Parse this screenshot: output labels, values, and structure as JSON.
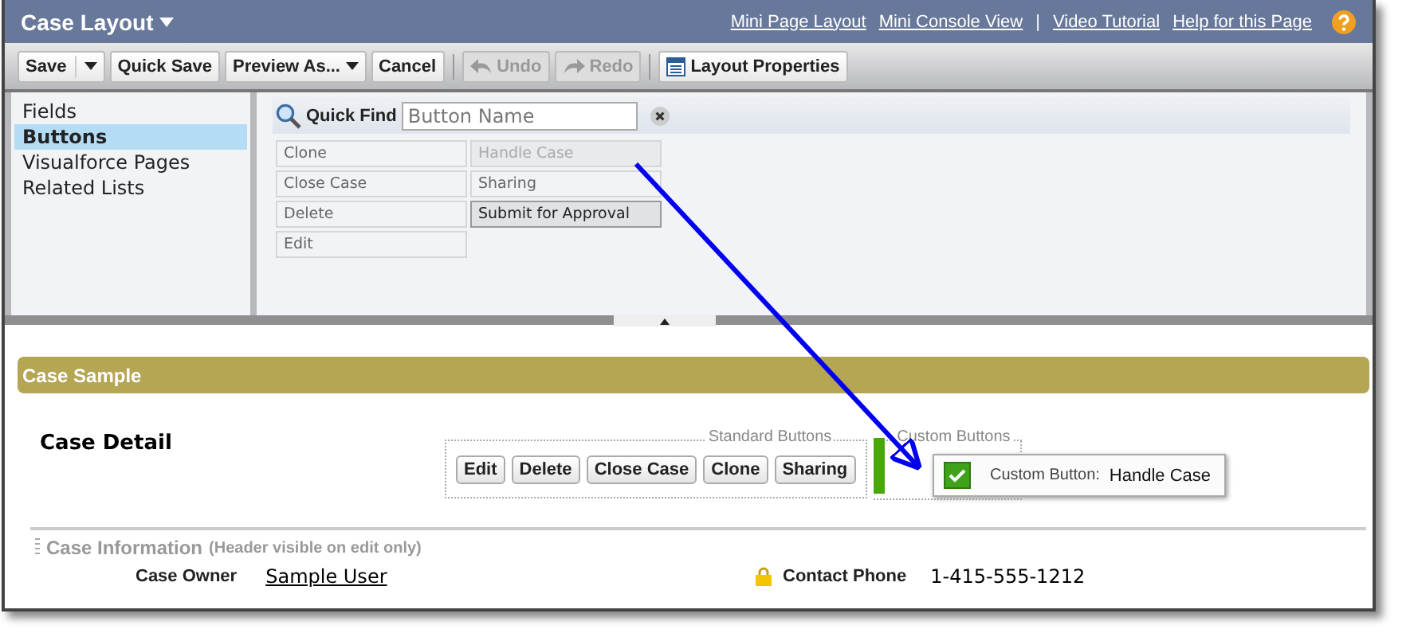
{
  "header": {
    "title": "Case Layout",
    "links": [
      {
        "label": "Mini Page Layout",
        "kind": "link"
      },
      {
        "label": "Mini Console View",
        "kind": "link"
      },
      {
        "label": "|",
        "kind": "separator"
      },
      {
        "label": "Video Tutorial",
        "kind": "link"
      },
      {
        "label": "Help for this Page",
        "kind": "link"
      }
    ]
  },
  "toolbar": [
    {
      "label": "Save",
      "kind": "split",
      "disabled": false
    },
    {
      "label": "Quick Save",
      "kind": "plain",
      "disabled": false
    },
    {
      "label": "Preview As...",
      "kind": "dropdown",
      "disabled": false
    },
    {
      "label": "Cancel",
      "kind": "plain",
      "disabled": false
    },
    {
      "label": "Undo",
      "kind": "undo",
      "disabled": true
    },
    {
      "label": "Redo",
      "kind": "redo",
      "disabled": true
    },
    {
      "label": "Layout Properties",
      "kind": "properties",
      "disabled": false
    }
  ],
  "sidebar": {
    "items": [
      {
        "label": "Fields",
        "selected": false
      },
      {
        "label": "Buttons",
        "selected": true
      },
      {
        "label": "Visualforce Pages",
        "selected": false
      },
      {
        "label": "Related Lists",
        "selected": false
      }
    ]
  },
  "quick_find": {
    "label": "Quick Find",
    "placeholder": "Button Name"
  },
  "palette": [
    {
      "label": "Clone",
      "in_use": false,
      "highlighted": false
    },
    {
      "label": "Close Case",
      "in_use": false,
      "highlighted": false
    },
    {
      "label": "Delete",
      "in_use": false,
      "highlighted": false
    },
    {
      "label": "Edit",
      "in_use": false,
      "highlighted": false
    },
    {
      "label": "Handle Case",
      "in_use": true,
      "highlighted": false
    },
    {
      "label": "Sharing",
      "in_use": false,
      "highlighted": false
    },
    {
      "label": "Submit for Approval",
      "in_use": false,
      "highlighted": true
    }
  ],
  "section_bar": "Case Sample",
  "detail": {
    "title": "Case Detail",
    "standard_legend": "Standard Buttons",
    "standard_buttons": [
      "Edit",
      "Delete",
      "Close Case",
      "Clone",
      "Sharing"
    ],
    "custom_legend": "Custom Buttons"
  },
  "dragged": {
    "label": "Custom Button:",
    "value": "Handle Case",
    "checked": true
  },
  "info": {
    "title": "Case Information",
    "note": "(Header visible on edit only)"
  },
  "fields": [
    {
      "label": "Case Owner",
      "value": "Sample User",
      "kind": "link"
    },
    {
      "label": "Contact Phone",
      "value": "1-415-555-1212",
      "kind": "locked"
    }
  ]
}
